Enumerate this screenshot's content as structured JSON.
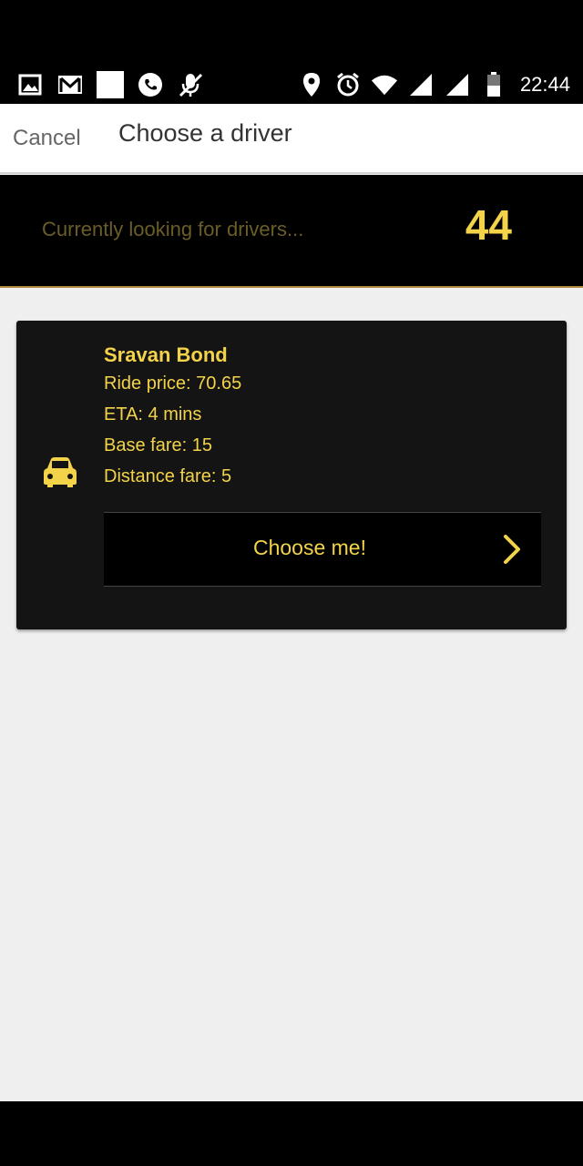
{
  "status_bar": {
    "time": "22:44",
    "left_icons": [
      "image-icon",
      "gmail-icon",
      "blank-square-icon",
      "whatsapp-icon",
      "mute-mic-icon"
    ],
    "right_icons": [
      "location-icon",
      "alarm-icon",
      "wifi-icon",
      "signal-icon",
      "signal-icon",
      "battery-icon"
    ]
  },
  "header": {
    "cancel_label": "Cancel",
    "title": "Choose a driver"
  },
  "search": {
    "status_text": "Currently looking for drivers...",
    "count": "44"
  },
  "driver": {
    "name": "Sravan Bond",
    "ride_price": "Ride price: 70.65",
    "eta": "ETA: 4 mins",
    "base_fare": "Base fare: 15",
    "distance_fare": "Distance fare: 5",
    "choose_label": "Choose me!",
    "icon": "car-icon"
  },
  "colors": {
    "accent": "#f3d34a",
    "card_bg": "#141414",
    "banner_bg": "#000000",
    "page_bg": "#efefef"
  }
}
